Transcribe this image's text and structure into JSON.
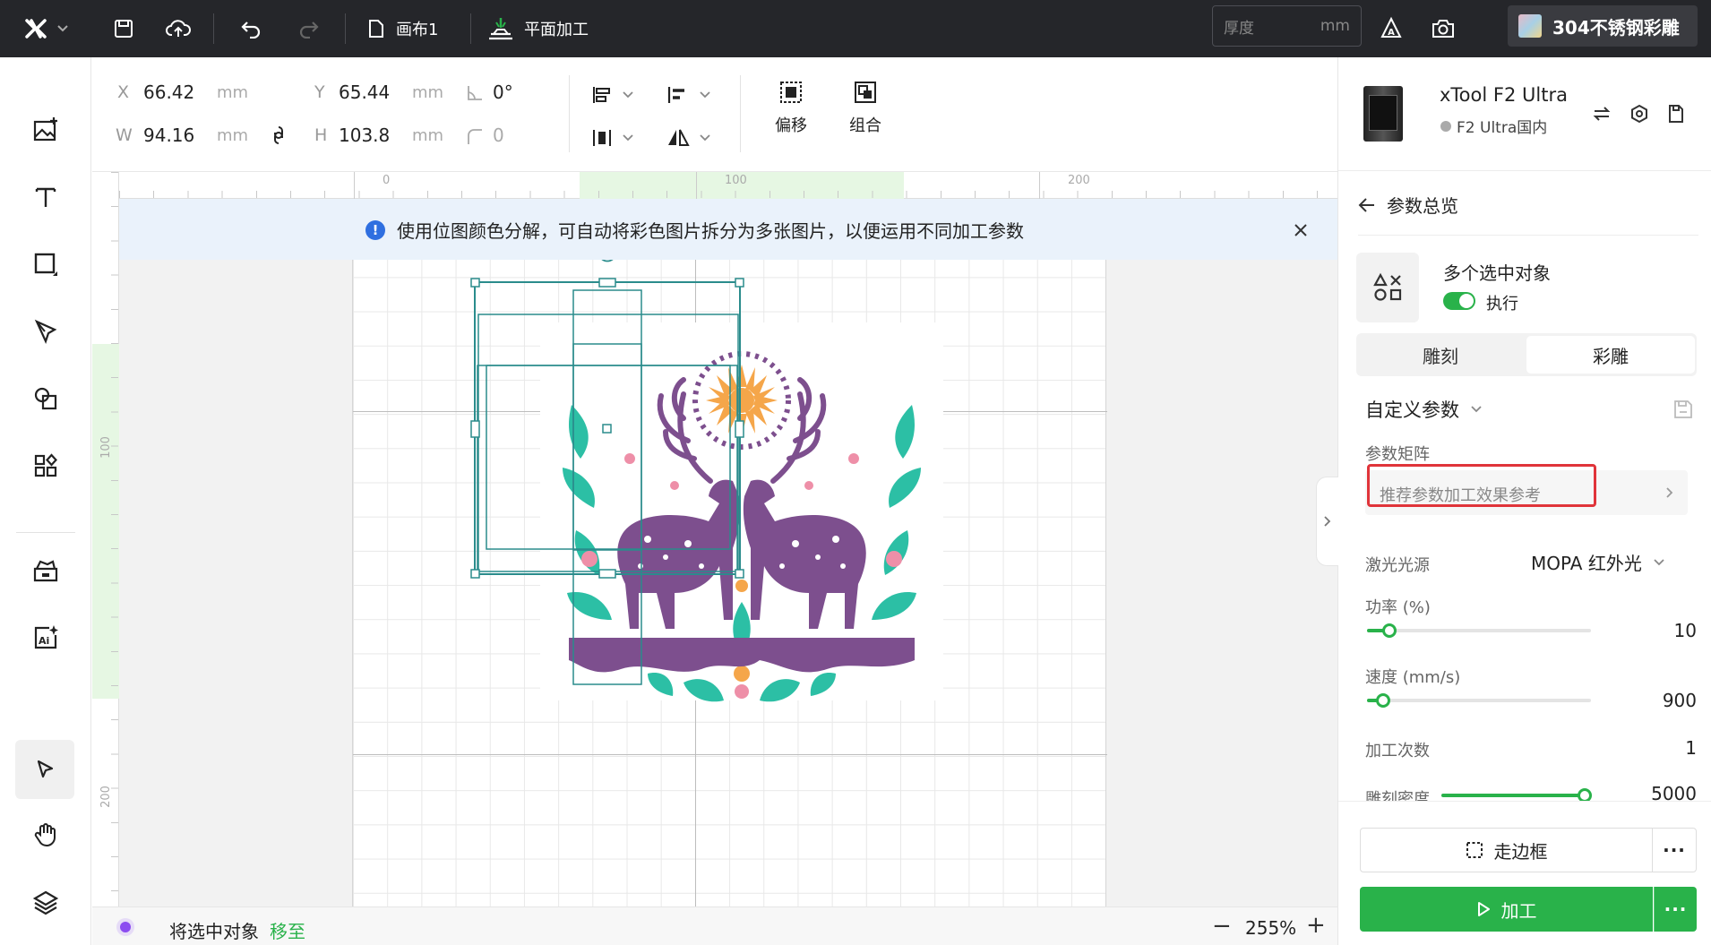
{
  "topbar": {
    "project_name": "画布1",
    "mode_label": "平面加工",
    "thickness_placeholder": "厚度",
    "thickness_unit": "mm",
    "material_label": "304不锈钢彩雕"
  },
  "props": {
    "x_label": "X",
    "x_value": "66.42",
    "x_unit": "mm",
    "y_label": "Y",
    "y_value": "65.44",
    "y_unit": "mm",
    "rotation_value": "0°",
    "w_label": "W",
    "w_value": "94.16",
    "w_unit": "mm",
    "h_label": "H",
    "h_value": "103.8",
    "h_unit": "mm",
    "corner_value": "0",
    "offset_label": "偏移",
    "group_label": "组合"
  },
  "ruler": {
    "h_ticks": [
      "0",
      "100",
      "200"
    ],
    "v_ticks": [
      "100",
      "200"
    ]
  },
  "notice": {
    "text": "使用位图颜色分解，可自动将彩色图片拆分为多张图片，以便运用不同加工参数"
  },
  "device": {
    "name": "xTool F2 Ultra",
    "region": "F2 Ultra国内"
  },
  "panel": {
    "back_label": "参数总览",
    "selection_title": "多个选中对象",
    "execute_label": "执行",
    "tabs": [
      "雕刻",
      "彩雕"
    ],
    "active_tab": "彩雕",
    "preset_label": "自定义参数",
    "matrix_label": "参数矩阵",
    "matrix_placeholder": "推荐参数加工效果参考",
    "laser_label": "激光光源",
    "laser_value": "MOPA 红外光",
    "power_label": "功率 (%)",
    "power_value": "10",
    "power_fraction": 0.1,
    "speed_label": "速度 (mm/s)",
    "speed_value": "900",
    "speed_fraction": 0.07,
    "passes_label": "加工次数",
    "passes_value": "1",
    "density_label": "雕刻密度",
    "density_value": "5000",
    "density_fraction": 1.0,
    "frame_label": "走边框",
    "process_label": "加工"
  },
  "status": {
    "move_text": "将选中对象",
    "move_link": "移至",
    "zoom": "255%"
  },
  "colors": {
    "accent_green": "#29b24a",
    "topbar_bg": "#25262a",
    "selection_teal": "#2a8c8c",
    "purple": "#7d4f8e",
    "orange": "#f5a64a",
    "teal": "#2cbfa5",
    "pink": "#ee8fa8"
  }
}
